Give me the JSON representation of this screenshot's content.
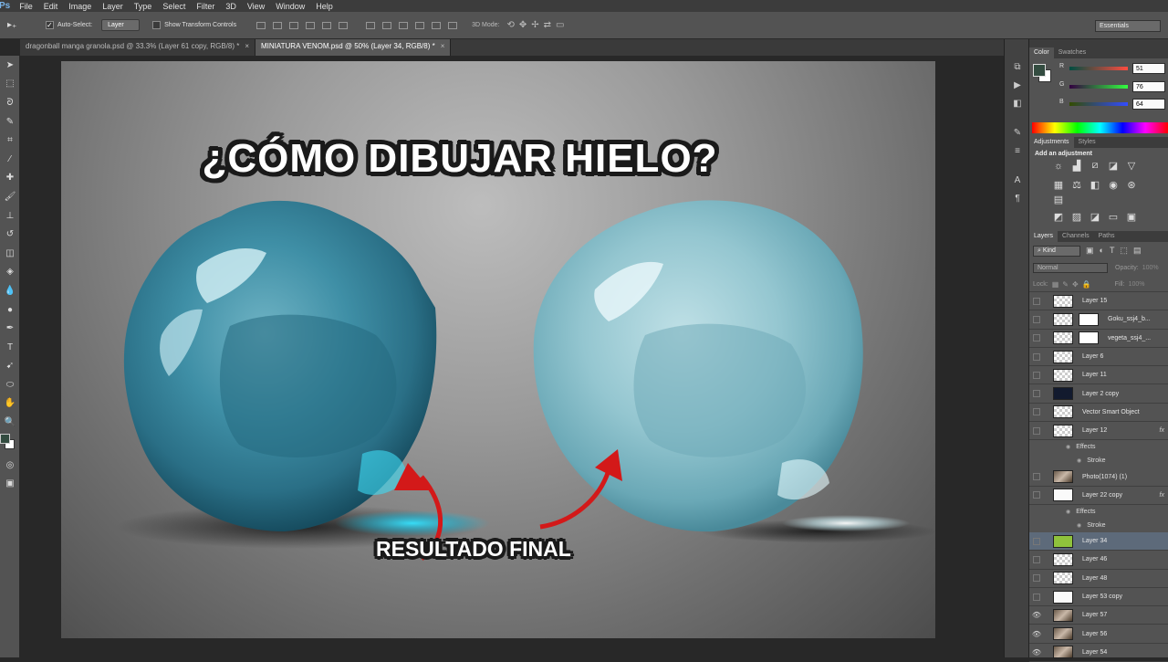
{
  "app": {
    "logo": "Ps",
    "menu": [
      "File",
      "Edit",
      "Image",
      "Layer",
      "Type",
      "Select",
      "Filter",
      "3D",
      "View",
      "Window",
      "Help"
    ]
  },
  "options": {
    "auto_select_label": "Auto-Select:",
    "auto_select_value": "Layer",
    "show_transform_label": "Show Transform Controls",
    "mode_label": "3D Mode:",
    "workspace": "Essentials"
  },
  "tabs": [
    {
      "label": "dragonball manga granola.psd @ 33.3% (Layer 61 copy, RGB/8) *",
      "close": "×"
    },
    {
      "label": "MINIATURA VENOM.psd @ 50% (Layer 34, RGB/8) *",
      "close": "×"
    }
  ],
  "canvas": {
    "title": "¿CÓMO DIBUJAR HIELO?",
    "caption": "RESULTADO FINAL"
  },
  "color_panel": {
    "tabs": [
      "Color",
      "Swatches"
    ],
    "r_label": "R",
    "g_label": "G",
    "b_label": "B",
    "r": "51",
    "g": "76",
    "b": "64",
    "fg_color": "#334c40",
    "bg_color": "#ffffff"
  },
  "adjustments_panel": {
    "tabs": [
      "Adjustments",
      "Styles"
    ],
    "heading": "Add an adjustment"
  },
  "layers_panel": {
    "tabs": [
      "Layers",
      "Channels",
      "Paths"
    ],
    "kind": "Kind",
    "blend": "Normal",
    "opacity_label": "Opacity:",
    "opacity": "100%",
    "lock_label": "Lock:",
    "fill_label": "Fill:",
    "fill": "100%",
    "layers": [
      {
        "name": "Layer 15",
        "visible": false,
        "thumb": "transparent"
      },
      {
        "name": "Goku_ssj4_b...",
        "visible": false,
        "thumb": "mask"
      },
      {
        "name": "vegeta_ssj4_...",
        "visible": false,
        "thumb": "mask"
      },
      {
        "name": "Layer 6",
        "visible": false,
        "thumb": "transparent"
      },
      {
        "name": "Layer 11",
        "visible": false,
        "thumb": "transparent"
      },
      {
        "name": "Layer 2 copy",
        "visible": false,
        "thumb": "dark"
      },
      {
        "name": "Vector Smart Object",
        "visible": false,
        "thumb": "transparent"
      },
      {
        "name": "Layer 12",
        "visible": false,
        "thumb": "transparent",
        "fx": true,
        "effects": [
          "Effects",
          "Stroke"
        ]
      },
      {
        "name": "Photo(1074) (1)",
        "visible": false,
        "thumb": "photo"
      },
      {
        "name": "Layer 22 copy",
        "visible": false,
        "thumb": "white",
        "fx": true,
        "effects": [
          "Effects",
          "Stroke"
        ]
      },
      {
        "name": "Layer 34",
        "visible": false,
        "thumb": "green",
        "selected": true
      },
      {
        "name": "Layer 46",
        "visible": false,
        "thumb": "transparent"
      },
      {
        "name": "Layer 48",
        "visible": false,
        "thumb": "transparent"
      },
      {
        "name": "Layer 53 copy",
        "visible": false,
        "thumb": "white"
      },
      {
        "name": "Layer 57",
        "visible": true,
        "thumb": "photo"
      },
      {
        "name": "Layer 56",
        "visible": true,
        "thumb": "photo"
      },
      {
        "name": "Layer 54",
        "visible": true,
        "thumb": "photo"
      }
    ]
  }
}
